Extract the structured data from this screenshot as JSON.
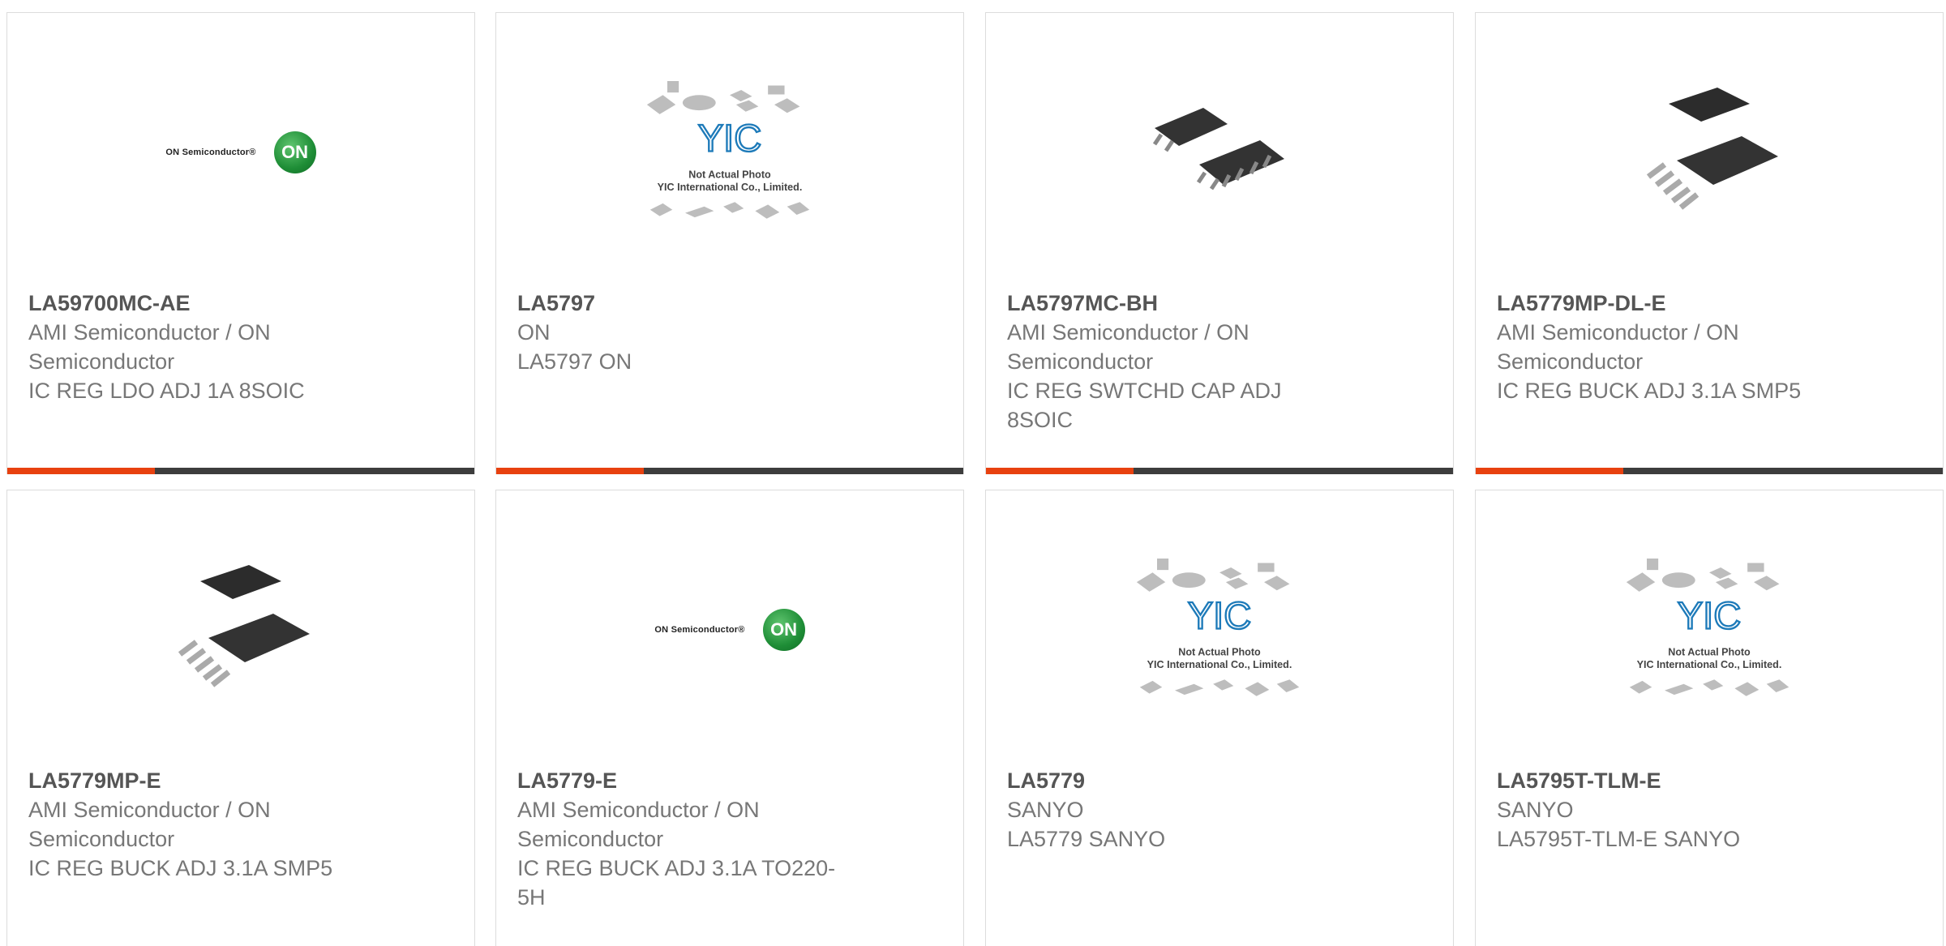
{
  "products": [
    {
      "part": "LA59700MC-AE",
      "manufacturer": "AMI Semiconductor / ON Semiconductor",
      "description": "IC REG LDO ADJ 1A 8SOIC",
      "image": "on-semiconductor-logo"
    },
    {
      "part": "LA5797",
      "manufacturer": "ON",
      "description": "LA5797 ON",
      "image": "yic-placeholder"
    },
    {
      "part": "LA5797MC-BH",
      "manufacturer": "AMI Semiconductor / ON Semiconductor",
      "description": "IC REG SWTCHD CAP ADJ 8SOIC",
      "image": "soic-chip-photo"
    },
    {
      "part": "LA5779MP-DL-E",
      "manufacturer": "AMI Semiconductor / ON Semiconductor",
      "description": "IC REG BUCK ADJ 3.1A SMP5",
      "image": "smp5-chip-photo"
    },
    {
      "part": "LA5779MP-E",
      "manufacturer": "AMI Semiconductor / ON Semiconductor",
      "description": "IC REG BUCK ADJ 3.1A SMP5",
      "image": "smp5-chip-photo"
    },
    {
      "part": "LA5779-E",
      "manufacturer": "AMI Semiconductor / ON Semiconductor",
      "description": "IC REG BUCK ADJ 3.1A TO220-5H",
      "image": "on-semiconductor-logo"
    },
    {
      "part": "LA5779",
      "manufacturer": "SANYO",
      "description": "LA5779 SANYO",
      "image": "yic-placeholder"
    },
    {
      "part": "LA5795T-TLM-E",
      "manufacturer": "SANYO",
      "description": "LA5795T-TLM-E SANYO",
      "image": "yic-placeholder"
    }
  ],
  "logos": {
    "on_text": "ON Semiconductor®",
    "on_badge": "ON",
    "yic_mark": "YIC",
    "yic_line1": "Not Actual Photo",
    "yic_line2": "YIC International Co., Limited."
  },
  "colors": {
    "accent": "#e8410f",
    "bar": "#3d3d3d",
    "part_text": "#555555",
    "meta_text": "#777777"
  }
}
